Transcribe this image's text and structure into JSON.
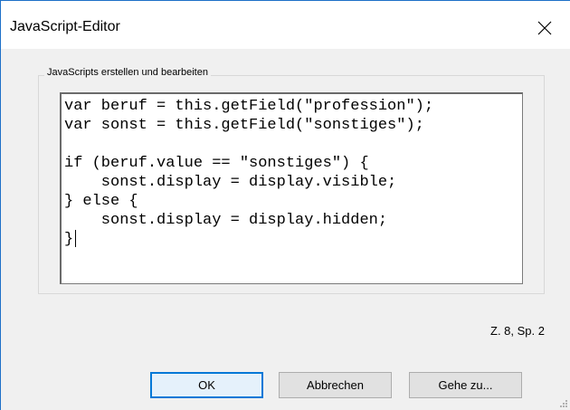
{
  "window": {
    "title": "JavaScript-Editor",
    "close_icon": "close-icon"
  },
  "group": {
    "label": "JavaScripts erstellen und bearbeiten"
  },
  "editor": {
    "lines": [
      "var beruf = this.getField(\"profession\");",
      "var sonst = this.getField(\"sonstiges\");",
      "",
      "if (beruf.value == \"sonstiges\") {",
      "    sonst.display = display.visible;",
      "} else {",
      "    sonst.display = display.hidden;",
      "}"
    ]
  },
  "status": {
    "cursor_position": "Z. 8, Sp. 2"
  },
  "buttons": {
    "ok": "OK",
    "cancel": "Abbrechen",
    "goto": "Gehe zu..."
  },
  "colors": {
    "accent": "#0078d7",
    "titlebar_border": "#1e70c8",
    "dialog_bg": "#f0f0f0"
  }
}
